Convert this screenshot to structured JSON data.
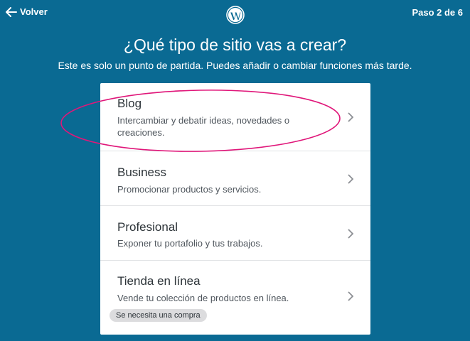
{
  "header": {
    "back_label": "Volver",
    "step_label": "Paso 2 de 6"
  },
  "main": {
    "title": "¿Qué tipo de sitio vas a crear?",
    "subtitle": "Este es solo un punto de partida. Puedes añadir o cambiar funciones más tarde."
  },
  "options": [
    {
      "title": "Blog",
      "description": "Intercambiar y debatir ideas, novedades o creaciones."
    },
    {
      "title": "Business",
      "description": "Promocionar productos y servicios."
    },
    {
      "title": "Profesional",
      "description": "Exponer tu portafolio y tus trabajos."
    },
    {
      "title": "Tienda en línea",
      "description": "Vende tu colección de productos en línea.",
      "badge": "Se necesita una compra"
    }
  ],
  "colors": {
    "background": "#0a6a93",
    "card": "#ffffff",
    "annotation": "#e0177a"
  },
  "icons": {
    "back": "arrow-left-icon",
    "logo": "wordpress-logo-icon",
    "chevron": "chevron-right-icon"
  }
}
